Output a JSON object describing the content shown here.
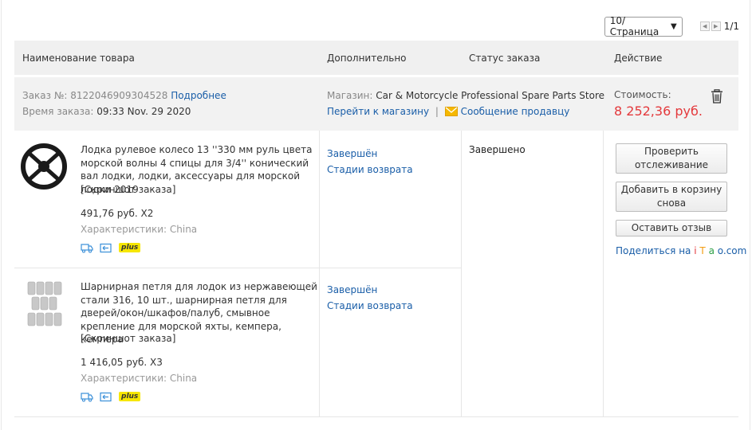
{
  "pager": {
    "per_page": "10/Страница",
    "page_count": "1/1"
  },
  "table_header": {
    "product": "Наименование товара",
    "extra": "Дополнительно",
    "status": "Статус заказа",
    "action": "Действие"
  },
  "order": {
    "number_label": "Заказ №:",
    "number": "8122046909304528",
    "details_link": "Подробнее",
    "time_label": "Время заказа:",
    "time": "09:33 Nov. 29 2020",
    "store_label": "Магазин:",
    "store_name": "Car & Motorcycle Professional Spare Parts Store",
    "go_to_store": "Перейти к магазину",
    "separator": "|",
    "message_seller": "Сообщение продавцу",
    "cost_label": "Стоимость:",
    "cost": "8 252,36 руб.",
    "status": "Завершено"
  },
  "items": [
    {
      "title": "Лодка рулевое колесо 13 ''330 мм руль цвета морской волны 4 спицы для 3/4'' конический вал лодки, лодки, аксессуары для морской лодки 2019",
      "snapshot": "[Скриншот заказа]",
      "price_qty": "491,76 руб. X2",
      "characteristics": "Характеристики: China",
      "badge": "plus",
      "status": "Завершён",
      "return_stages": "Стадии возврата"
    },
    {
      "title": "Шарнирная петля для лодок из нержавеющей стали 316, 10 шт., шарнирная петля для дверей/окон/шкафов/палуб, смывное крепление для морской яхты, кемпера, кемпера",
      "snapshot": "[Скриншот заказа]",
      "price_qty": "1 416,05 руб. X3",
      "characteristics": "Характеристики: China",
      "badge": "plus",
      "status": "Завершён",
      "return_stages": "Стадии возврата"
    }
  ],
  "actions": {
    "track": "Проверить отслеживание",
    "add_to_cart": "Добавить в корзину снова",
    "review": "Оставить отзыв",
    "share_prefix": "Поделиться на ",
    "share_i": "i",
    "share_t": "T",
    "share_a": "a",
    "share_o": "o.com"
  },
  "colors": {
    "link": "#1a5ea8",
    "price": "#e4393c",
    "header_bg": "#f0f0f0",
    "badge": "#f6e600"
  }
}
